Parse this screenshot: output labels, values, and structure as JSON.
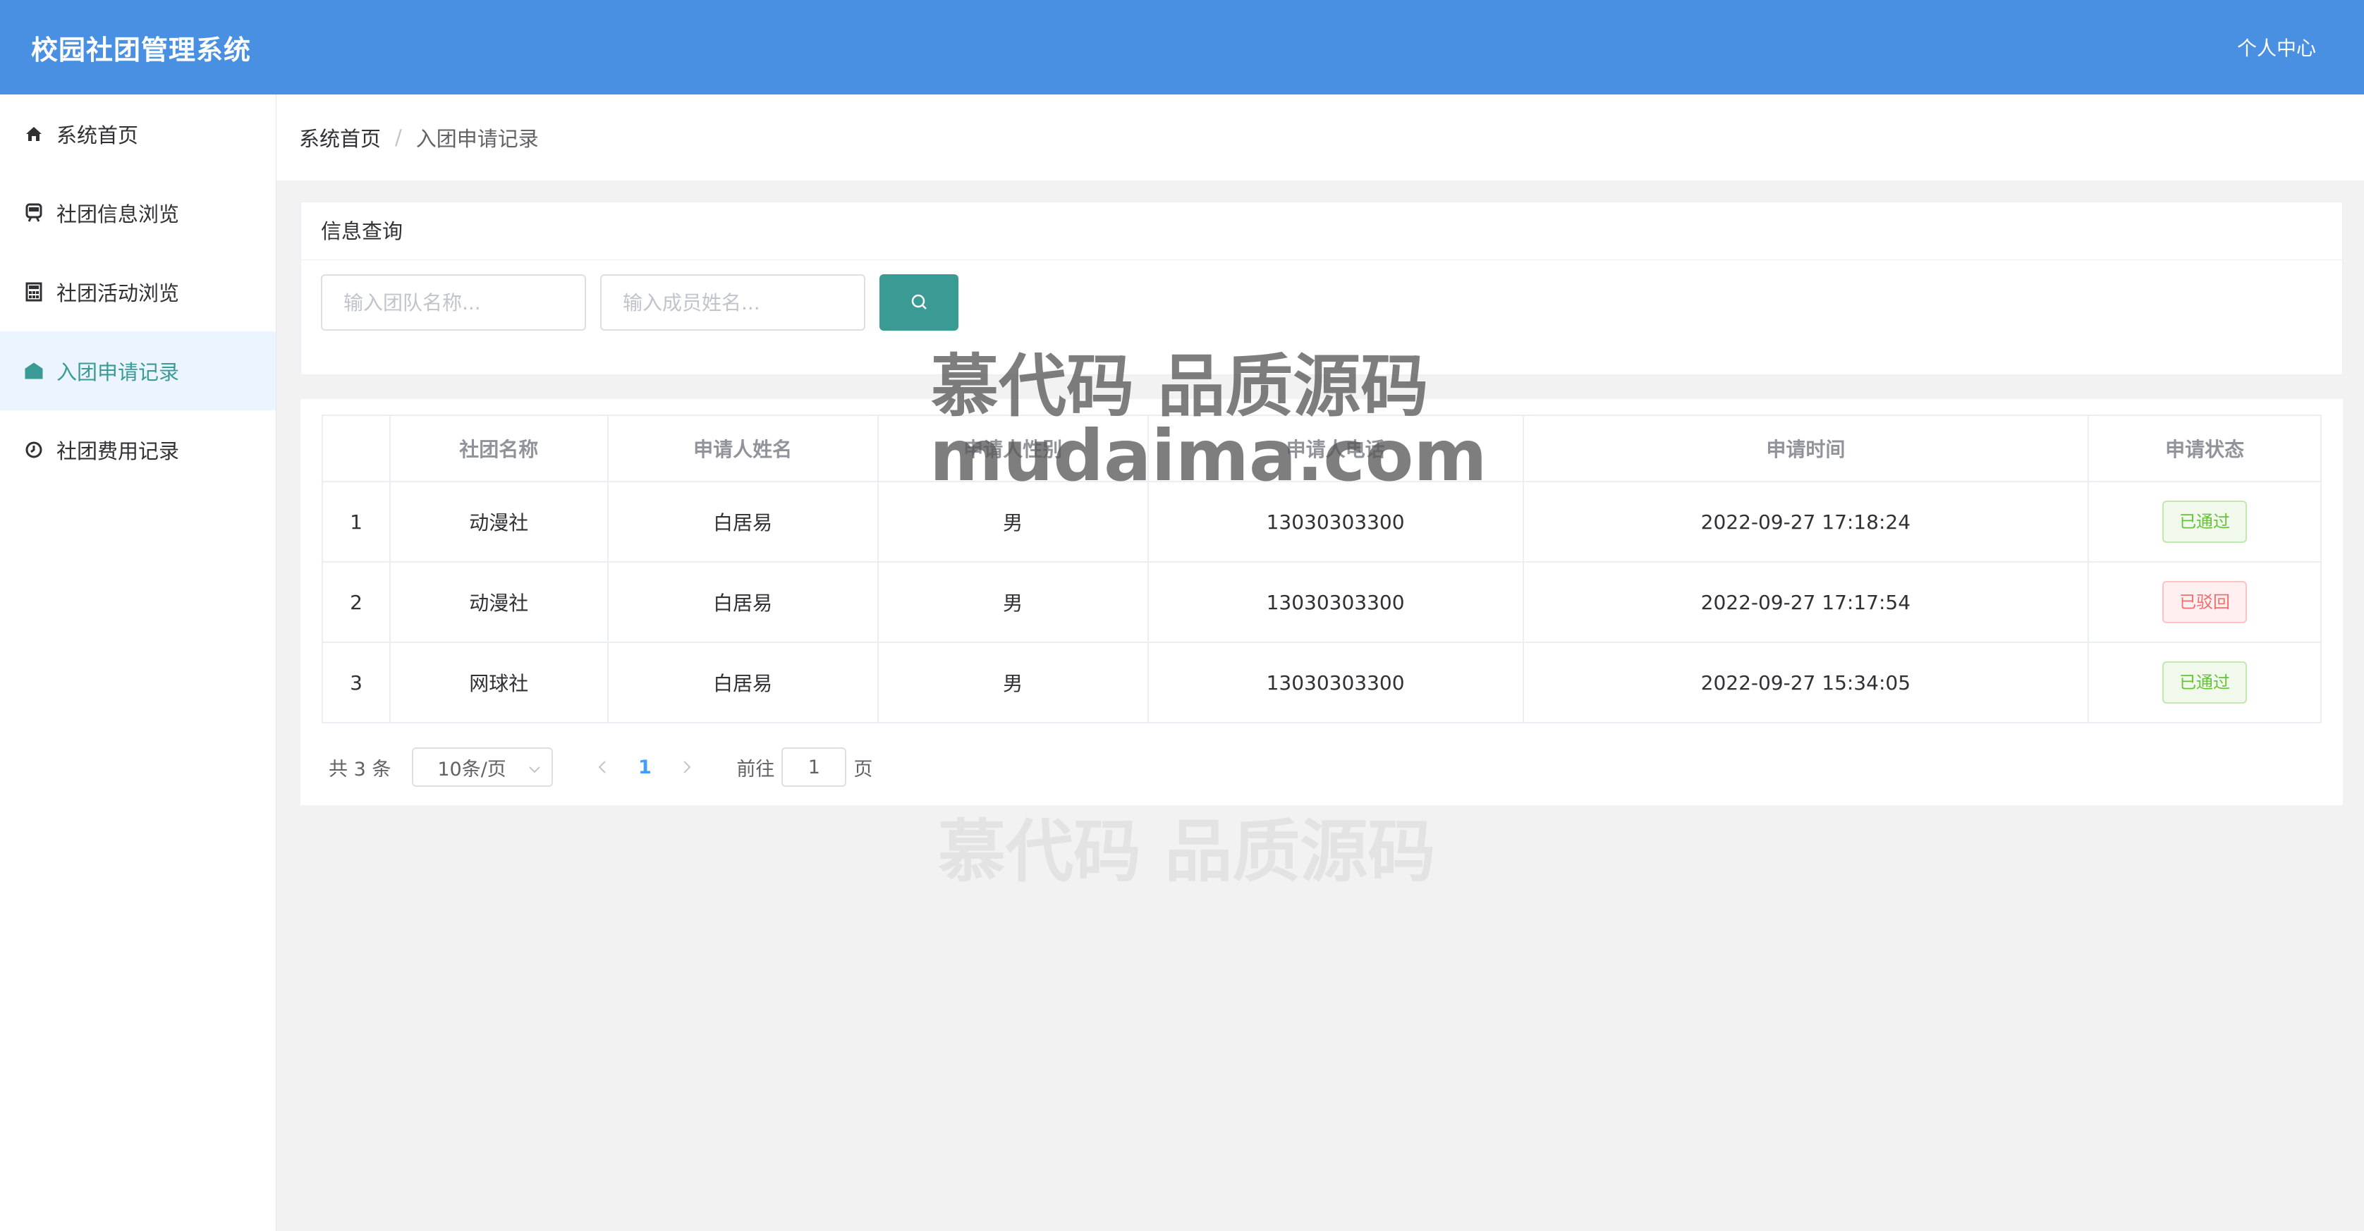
{
  "header": {
    "title": "校园社团管理系统",
    "profile_link": "个人中心"
  },
  "sidebar": {
    "items": [
      {
        "label": "系统首页",
        "icon": "home-icon"
      },
      {
        "label": "社团信息浏览",
        "icon": "train-icon"
      },
      {
        "label": "社团活动浏览",
        "icon": "calculator-icon"
      },
      {
        "label": "入团申请记录",
        "icon": "envelope-open-icon",
        "active": true
      },
      {
        "label": "社团费用记录",
        "icon": "clock-icon"
      }
    ]
  },
  "breadcrumb": {
    "home": "系统首页",
    "separator": "/",
    "current": "入团申请记录"
  },
  "query": {
    "title": "信息查询",
    "team_placeholder": "输入团队名称...",
    "member_placeholder": "输入成员姓名...",
    "search_icon": "search-icon"
  },
  "table": {
    "headers": [
      "",
      "社团名称",
      "申请人姓名",
      "申请人性别",
      "申请人电话",
      "申请时间",
      "申请状态"
    ],
    "rows": [
      {
        "index": "1",
        "club": "动漫社",
        "name": "白居易",
        "gender": "男",
        "phone": "13030303300",
        "time": "2022-09-27 17:18:24",
        "status": "已通过",
        "status_type": "ok"
      },
      {
        "index": "2",
        "club": "动漫社",
        "name": "白居易",
        "gender": "男",
        "phone": "13030303300",
        "time": "2022-09-27 17:17:54",
        "status": "已驳回",
        "status_type": "no"
      },
      {
        "index": "3",
        "club": "网球社",
        "name": "白居易",
        "gender": "男",
        "phone": "13030303300",
        "time": "2022-09-27 15:34:05",
        "status": "已通过",
        "status_type": "ok"
      }
    ]
  },
  "pagination": {
    "total": "共 3 条",
    "page_size": "10条/页",
    "current_page": "1",
    "goto_label": "前往",
    "goto_value": "1",
    "page_unit": "页"
  },
  "watermark": {
    "line1": "慕代码 品质源码",
    "line2": "mudaima.com",
    "line3": "慕代码 品质源码"
  },
  "colors": {
    "header_bg": "#4a90e2",
    "accent": "#3a9b94",
    "approved": "#67c23a",
    "rejected": "#f56c6c"
  }
}
